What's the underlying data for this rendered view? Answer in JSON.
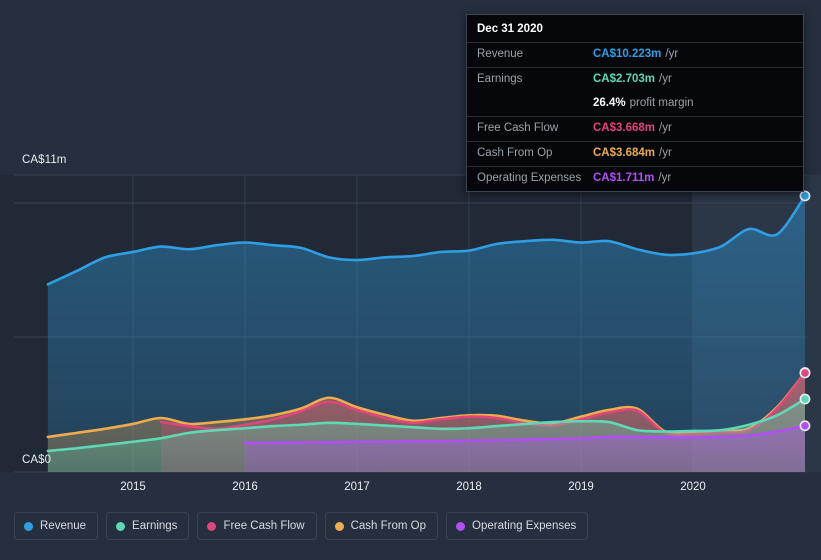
{
  "axis": {
    "y_top_label": "CA$11m",
    "y_zero_label": "CA$0",
    "x_ticks": [
      "2015",
      "2016",
      "2017",
      "2018",
      "2019",
      "2020"
    ]
  },
  "tooltip": {
    "title": "Dec 31 2020",
    "rows": [
      {
        "key": "Revenue",
        "value": "CA$10.223m",
        "unit": "/yr",
        "color": "#2f9fe3"
      },
      {
        "key": "Earnings",
        "value": "CA$2.703m",
        "unit": "/yr",
        "color": "#5fd9b5"
      },
      {
        "key": "",
        "value": "26.4%",
        "unit": "profit margin",
        "color": "#ffffff"
      },
      {
        "key": "Free Cash Flow",
        "value": "CA$3.668m",
        "unit": "/yr",
        "color": "#e0457b"
      },
      {
        "key": "Cash From Op",
        "value": "CA$3.684m",
        "unit": "/yr",
        "color": "#eeac4d"
      },
      {
        "key": "Operating Expenses",
        "value": "CA$1.711m",
        "unit": "/yr",
        "color": "#b14ff5"
      }
    ]
  },
  "legend": {
    "items": [
      {
        "label": "Revenue",
        "color": "#2f9fe3"
      },
      {
        "label": "Earnings",
        "color": "#5fd9b5"
      },
      {
        "label": "Free Cash Flow",
        "color": "#e0457b"
      },
      {
        "label": "Cash From Op",
        "color": "#eeac4d"
      },
      {
        "label": "Operating Expenses",
        "color": "#b14ff5"
      }
    ]
  },
  "chart_data": {
    "type": "area",
    "title": "",
    "xlabel": "",
    "ylabel": "CA$",
    "ylim": [
      0,
      11
    ],
    "ytick_labels": [
      "CA$0",
      "CA$11m"
    ],
    "grid": true,
    "legend_position": "bottom",
    "currency": "CA$",
    "unit": "m",
    "forecast_start_year": 2020,
    "x_tick_years": [
      2015,
      2016,
      2017,
      2018,
      2019,
      2020
    ],
    "x": [
      2014.24,
      2014.5,
      2014.75,
      2015.0,
      2015.25,
      2015.5,
      2015.75,
      2016.0,
      2016.25,
      2016.5,
      2016.75,
      2017.0,
      2017.25,
      2017.5,
      2017.75,
      2018.0,
      2018.25,
      2018.5,
      2018.75,
      2019.0,
      2019.25,
      2019.5,
      2019.75,
      2020.0,
      2020.25,
      2020.5,
      2020.75,
      2021.0
    ],
    "series": [
      {
        "name": "Revenue",
        "color": "#2f9fe3",
        "values": [
          6.95,
          7.45,
          7.95,
          8.15,
          8.35,
          8.25,
          8.4,
          8.5,
          8.4,
          8.3,
          7.95,
          7.85,
          7.95,
          8.0,
          8.15,
          8.2,
          8.45,
          8.55,
          8.6,
          8.5,
          8.55,
          8.25,
          8.05,
          8.1,
          8.35,
          9.0,
          8.8,
          10.223
        ],
        "end_value": 10.223,
        "end_label": "CA$10.223m"
      },
      {
        "name": "Earnings",
        "color": "#5fd9b5",
        "values": [
          0.78,
          0.88,
          1.0,
          1.12,
          1.25,
          1.45,
          1.55,
          1.62,
          1.7,
          1.75,
          1.82,
          1.78,
          1.72,
          1.66,
          1.6,
          1.62,
          1.7,
          1.78,
          1.85,
          1.88,
          1.85,
          1.55,
          1.5,
          1.52,
          1.55,
          1.75,
          2.1,
          2.703
        ],
        "end_value": 2.703,
        "end_label": "CA$2.703m"
      },
      {
        "name": "Free Cash Flow",
        "color": "#e0457b",
        "values": [
          null,
          null,
          null,
          null,
          1.85,
          1.7,
          1.6,
          1.75,
          1.95,
          2.25,
          2.6,
          2.3,
          2.0,
          1.82,
          1.95,
          2.05,
          2.0,
          1.8,
          1.72,
          1.95,
          2.2,
          2.28,
          1.45,
          1.4,
          1.45,
          1.55,
          2.35,
          3.668
        ],
        "end_value": 3.668,
        "end_label": "CA$3.668m"
      },
      {
        "name": "Cash From Op",
        "color": "#eeac4d",
        "values": [
          1.3,
          1.45,
          1.6,
          1.78,
          2.0,
          1.78,
          1.85,
          1.95,
          2.1,
          2.35,
          2.75,
          2.4,
          2.12,
          1.9,
          2.0,
          2.1,
          2.08,
          1.9,
          1.8,
          2.05,
          2.3,
          2.35,
          1.5,
          1.45,
          1.52,
          1.62,
          2.4,
          3.684
        ],
        "end_value": 3.684,
        "end_label": "CA$3.684m"
      },
      {
        "name": "Operating Expenses",
        "color": "#b14ff5",
        "values": [
          null,
          null,
          null,
          null,
          null,
          null,
          null,
          1.08,
          1.08,
          1.1,
          1.1,
          1.12,
          1.12,
          1.14,
          1.14,
          1.16,
          1.18,
          1.2,
          1.22,
          1.25,
          1.3,
          1.3,
          1.28,
          1.28,
          1.3,
          1.35,
          1.5,
          1.711
        ],
        "end_value": 1.711,
        "end_label": "CA$1.711m"
      }
    ]
  },
  "colors": {
    "background": "#262f3d",
    "plot_background": "#212936",
    "forecast_background": "#26303f",
    "gridline": "#39424f",
    "text": "#e9ecf1",
    "muted_text": "#9ba3ad"
  }
}
